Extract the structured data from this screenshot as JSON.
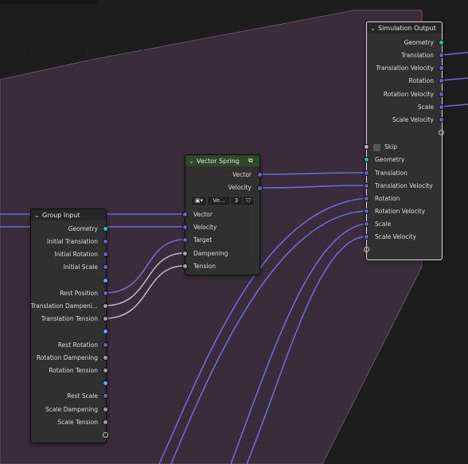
{
  "group_input": {
    "title": "Group Input",
    "outputs": [
      "Geometry",
      "Initial Translation",
      "Initial Rotation",
      "Initial Scale",
      "",
      "Rest Position",
      "Translation Dampeni...",
      "Translation Tension",
      "",
      "Rest Rotation",
      "Rotation Dampening",
      "Rotation Tension",
      "",
      "Rest Scale",
      "Scale Dampening",
      "Scale Tension"
    ]
  },
  "vector_spring": {
    "title": "Vector Spring",
    "outputs": [
      "Vector",
      "Velocity"
    ],
    "group_name": "Ve...",
    "user_count": "3",
    "inputs": [
      "Vector",
      "Velocity",
      "Target",
      "Dampening",
      "Tension"
    ]
  },
  "simulation_output": {
    "title": "Simulation Output",
    "outputs": [
      "Geometry",
      "Translation",
      "Translation Velocity",
      "Rotation",
      "Rotation Velocity",
      "Scale",
      "Scale Velocity"
    ],
    "skip_label": "Skip",
    "inputs": [
      "Geometry",
      "Translation",
      "Translation Velocity",
      "Rotation",
      "Rotation Velocity",
      "Scale",
      "Scale Velocity"
    ]
  },
  "colors": {
    "background": "#1d1d1d",
    "node_body": "#303030",
    "simulation_zone": "#3a2d3a",
    "geometry_socket": "#00d6a3",
    "vector_socket": "#6363c7",
    "float_socket": "#a1a1a1",
    "link_vector": "#6b6bd6",
    "link_float": "#b9b9b9"
  }
}
